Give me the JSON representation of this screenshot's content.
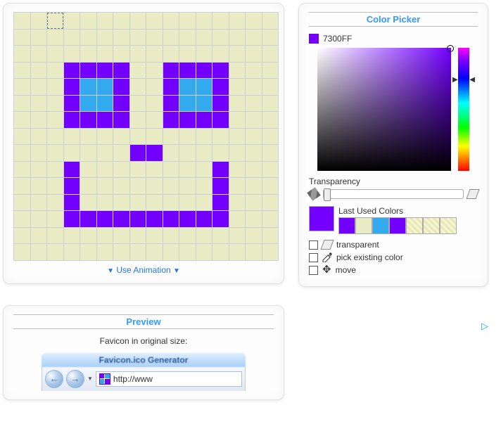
{
  "editor": {
    "use_animation": "Use Animation",
    "grid": {
      "cols": 16,
      "rows": 15,
      "selected": {
        "r": 0,
        "c": 2
      },
      "pixels": {
        "purple": [
          [
            3,
            3
          ],
          [
            3,
            4
          ],
          [
            3,
            5
          ],
          [
            3,
            6
          ],
          [
            3,
            9
          ],
          [
            3,
            10
          ],
          [
            3,
            11
          ],
          [
            3,
            12
          ],
          [
            4,
            3
          ],
          [
            4,
            6
          ],
          [
            4,
            9
          ],
          [
            4,
            12
          ],
          [
            5,
            3
          ],
          [
            5,
            6
          ],
          [
            5,
            9
          ],
          [
            5,
            12
          ],
          [
            6,
            3
          ],
          [
            6,
            4
          ],
          [
            6,
            5
          ],
          [
            6,
            6
          ],
          [
            6,
            9
          ],
          [
            6,
            10
          ],
          [
            6,
            11
          ],
          [
            6,
            12
          ],
          [
            8,
            7
          ],
          [
            8,
            8
          ],
          [
            9,
            3
          ],
          [
            9,
            12
          ],
          [
            10,
            3
          ],
          [
            10,
            12
          ],
          [
            11,
            3
          ],
          [
            11,
            12
          ],
          [
            12,
            3
          ],
          [
            12,
            4
          ],
          [
            12,
            5
          ],
          [
            12,
            6
          ],
          [
            12,
            7
          ],
          [
            12,
            8
          ],
          [
            12,
            9
          ],
          [
            12,
            10
          ],
          [
            12,
            11
          ],
          [
            12,
            12
          ]
        ],
        "cyan": [
          [
            4,
            4
          ],
          [
            4,
            5
          ],
          [
            4,
            10
          ],
          [
            4,
            11
          ],
          [
            5,
            4
          ],
          [
            5,
            5
          ],
          [
            5,
            10
          ],
          [
            5,
            11
          ]
        ]
      }
    }
  },
  "picker": {
    "title": "Color Picker",
    "current_hex": "7300FF",
    "transparency_label": "Transparency",
    "last_used_label": "Last Used Colors",
    "last_used": [
      "#7300ff",
      "#eaecc6",
      "#33aaee",
      "#7300ff",
      "hatch",
      "hatch",
      "hatch"
    ],
    "options": {
      "transparent": "transparent",
      "pick_existing": "pick existing color",
      "move": "move"
    }
  },
  "preview": {
    "title": "Preview",
    "orig_size_label": "Favicon in original size:",
    "browser_title": "Favicon.ico Generator",
    "address": "http://www"
  }
}
